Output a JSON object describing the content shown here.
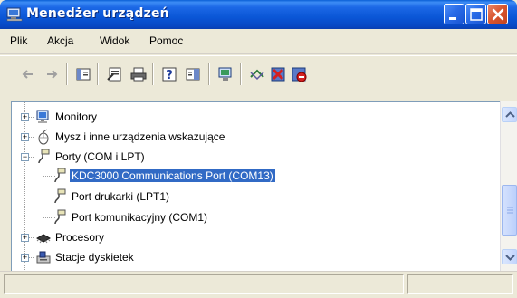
{
  "window": {
    "title": "Menedżer urządzeń"
  },
  "menu": {
    "items": [
      "Plik",
      "Akcja",
      "Widok",
      "Pomoc"
    ]
  },
  "toolbar": {
    "icons": [
      "back-arrow-icon",
      "forward-arrow-icon",
      "console-tree-icon",
      "properties-icon",
      "print-icon",
      "help-icon",
      "show-hide-icon",
      "scan-hardware-icon",
      "update-driver-icon",
      "uninstall-icon",
      "disable-icon"
    ]
  },
  "tree": {
    "items": [
      {
        "label": "Monitory",
        "icon": "monitor-icon",
        "expander": "+"
      },
      {
        "label": "Mysz i inne urządzenia wskazujące",
        "icon": "mouse-icon",
        "expander": "+"
      },
      {
        "label": "Porty (COM i LPT)",
        "icon": "port-icon",
        "expander": "−"
      },
      {
        "label": "KDC3000 Communications Port (COM13)",
        "icon": "port-icon",
        "selected": true
      },
      {
        "label": "Port drukarki (LPT1)",
        "icon": "port-icon"
      },
      {
        "label": "Port komunikacyjny (COM1)",
        "icon": "port-icon"
      },
      {
        "label": "Procesory",
        "icon": "processor-icon",
        "expander": "+"
      },
      {
        "label": "Stacje dyskietek",
        "icon": "floppy-icon",
        "expander": "+"
      }
    ]
  },
  "colors": {
    "titlebar": "#0a56d6",
    "selection": "#316ac5",
    "window_bg": "#ece9d8"
  }
}
